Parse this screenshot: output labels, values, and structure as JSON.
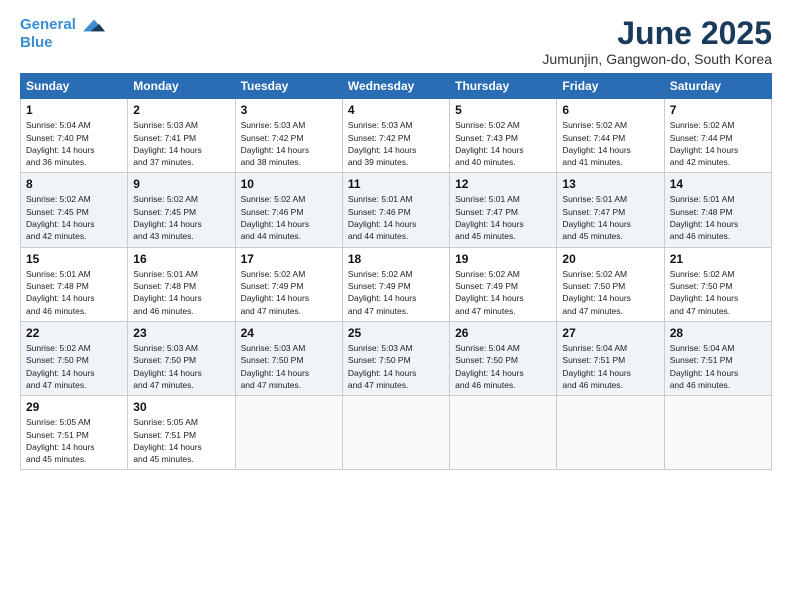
{
  "logo": {
    "line1": "General",
    "line2": "Blue"
  },
  "title": "June 2025",
  "location": "Jumunjin, Gangwon-do, South Korea",
  "weekdays": [
    "Sunday",
    "Monday",
    "Tuesday",
    "Wednesday",
    "Thursday",
    "Friday",
    "Saturday"
  ],
  "days": [
    {
      "date": 1,
      "sunrise": "5:04 AM",
      "sunset": "7:40 PM",
      "daylight": "14 hours and 36 minutes."
    },
    {
      "date": 2,
      "sunrise": "5:03 AM",
      "sunset": "7:41 PM",
      "daylight": "14 hours and 37 minutes."
    },
    {
      "date": 3,
      "sunrise": "5:03 AM",
      "sunset": "7:42 PM",
      "daylight": "14 hours and 38 minutes."
    },
    {
      "date": 4,
      "sunrise": "5:03 AM",
      "sunset": "7:42 PM",
      "daylight": "14 hours and 39 minutes."
    },
    {
      "date": 5,
      "sunrise": "5:02 AM",
      "sunset": "7:43 PM",
      "daylight": "14 hours and 40 minutes."
    },
    {
      "date": 6,
      "sunrise": "5:02 AM",
      "sunset": "7:44 PM",
      "daylight": "14 hours and 41 minutes."
    },
    {
      "date": 7,
      "sunrise": "5:02 AM",
      "sunset": "7:44 PM",
      "daylight": "14 hours and 42 minutes."
    },
    {
      "date": 8,
      "sunrise": "5:02 AM",
      "sunset": "7:45 PM",
      "daylight": "14 hours and 42 minutes."
    },
    {
      "date": 9,
      "sunrise": "5:02 AM",
      "sunset": "7:45 PM",
      "daylight": "14 hours and 43 minutes."
    },
    {
      "date": 10,
      "sunrise": "5:02 AM",
      "sunset": "7:46 PM",
      "daylight": "14 hours and 44 minutes."
    },
    {
      "date": 11,
      "sunrise": "5:01 AM",
      "sunset": "7:46 PM",
      "daylight": "14 hours and 44 minutes."
    },
    {
      "date": 12,
      "sunrise": "5:01 AM",
      "sunset": "7:47 PM",
      "daylight": "14 hours and 45 minutes."
    },
    {
      "date": 13,
      "sunrise": "5:01 AM",
      "sunset": "7:47 PM",
      "daylight": "14 hours and 45 minutes."
    },
    {
      "date": 14,
      "sunrise": "5:01 AM",
      "sunset": "7:48 PM",
      "daylight": "14 hours and 46 minutes."
    },
    {
      "date": 15,
      "sunrise": "5:01 AM",
      "sunset": "7:48 PM",
      "daylight": "14 hours and 46 minutes."
    },
    {
      "date": 16,
      "sunrise": "5:01 AM",
      "sunset": "7:48 PM",
      "daylight": "14 hours and 46 minutes."
    },
    {
      "date": 17,
      "sunrise": "5:02 AM",
      "sunset": "7:49 PM",
      "daylight": "14 hours and 47 minutes."
    },
    {
      "date": 18,
      "sunrise": "5:02 AM",
      "sunset": "7:49 PM",
      "daylight": "14 hours and 47 minutes."
    },
    {
      "date": 19,
      "sunrise": "5:02 AM",
      "sunset": "7:49 PM",
      "daylight": "14 hours and 47 minutes."
    },
    {
      "date": 20,
      "sunrise": "5:02 AM",
      "sunset": "7:50 PM",
      "daylight": "14 hours and 47 minutes."
    },
    {
      "date": 21,
      "sunrise": "5:02 AM",
      "sunset": "7:50 PM",
      "daylight": "14 hours and 47 minutes."
    },
    {
      "date": 22,
      "sunrise": "5:02 AM",
      "sunset": "7:50 PM",
      "daylight": "14 hours and 47 minutes."
    },
    {
      "date": 23,
      "sunrise": "5:03 AM",
      "sunset": "7:50 PM",
      "daylight": "14 hours and 47 minutes."
    },
    {
      "date": 24,
      "sunrise": "5:03 AM",
      "sunset": "7:50 PM",
      "daylight": "14 hours and 47 minutes."
    },
    {
      "date": 25,
      "sunrise": "5:03 AM",
      "sunset": "7:50 PM",
      "daylight": "14 hours and 47 minutes."
    },
    {
      "date": 26,
      "sunrise": "5:04 AM",
      "sunset": "7:50 PM",
      "daylight": "14 hours and 46 minutes."
    },
    {
      "date": 27,
      "sunrise": "5:04 AM",
      "sunset": "7:51 PM",
      "daylight": "14 hours and 46 minutes."
    },
    {
      "date": 28,
      "sunrise": "5:04 AM",
      "sunset": "7:51 PM",
      "daylight": "14 hours and 46 minutes."
    },
    {
      "date": 29,
      "sunrise": "5:05 AM",
      "sunset": "7:51 PM",
      "daylight": "14 hours and 45 minutes."
    },
    {
      "date": 30,
      "sunrise": "5:05 AM",
      "sunset": "7:51 PM",
      "daylight": "14 hours and 45 minutes."
    }
  ]
}
